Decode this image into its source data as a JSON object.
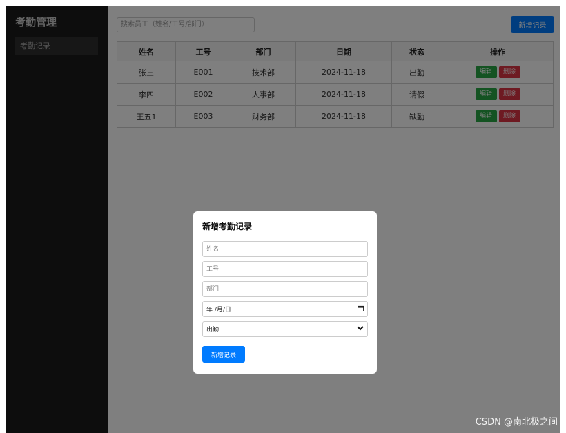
{
  "sidebar": {
    "title": "考勤管理",
    "items": [
      {
        "label": "考勤记录"
      }
    ]
  },
  "toolbar": {
    "search_placeholder": "搜索员工（姓名/工号/部门）",
    "add_label": "新增记录"
  },
  "table": {
    "headers": [
      "姓名",
      "工号",
      "部门",
      "日期",
      "状态",
      "操作"
    ],
    "rows": [
      {
        "name": "张三",
        "id": "E001",
        "dept": "技术部",
        "date": "2024-11-18",
        "status": "出勤"
      },
      {
        "name": "李四",
        "id": "E002",
        "dept": "人事部",
        "date": "2024-11-18",
        "status": "请假"
      },
      {
        "name": "王五1",
        "id": "E003",
        "dept": "财务部",
        "date": "2024-11-18",
        "status": "缺勤"
      }
    ],
    "edit_label": "编辑",
    "delete_label": "删除"
  },
  "modal": {
    "title": "新增考勤记录",
    "name_placeholder": "姓名",
    "id_placeholder": "工号",
    "dept_placeholder": "部门",
    "date_placeholder": "年 /月/日",
    "status_selected": "出勤",
    "submit_label": "新增记录"
  },
  "watermark": "CSDN @南北极之间",
  "colors": {
    "primary": "#007bff",
    "edit": "#28a745",
    "delete": "#dc3545",
    "sidebar_bg": "#1b1b1b"
  }
}
